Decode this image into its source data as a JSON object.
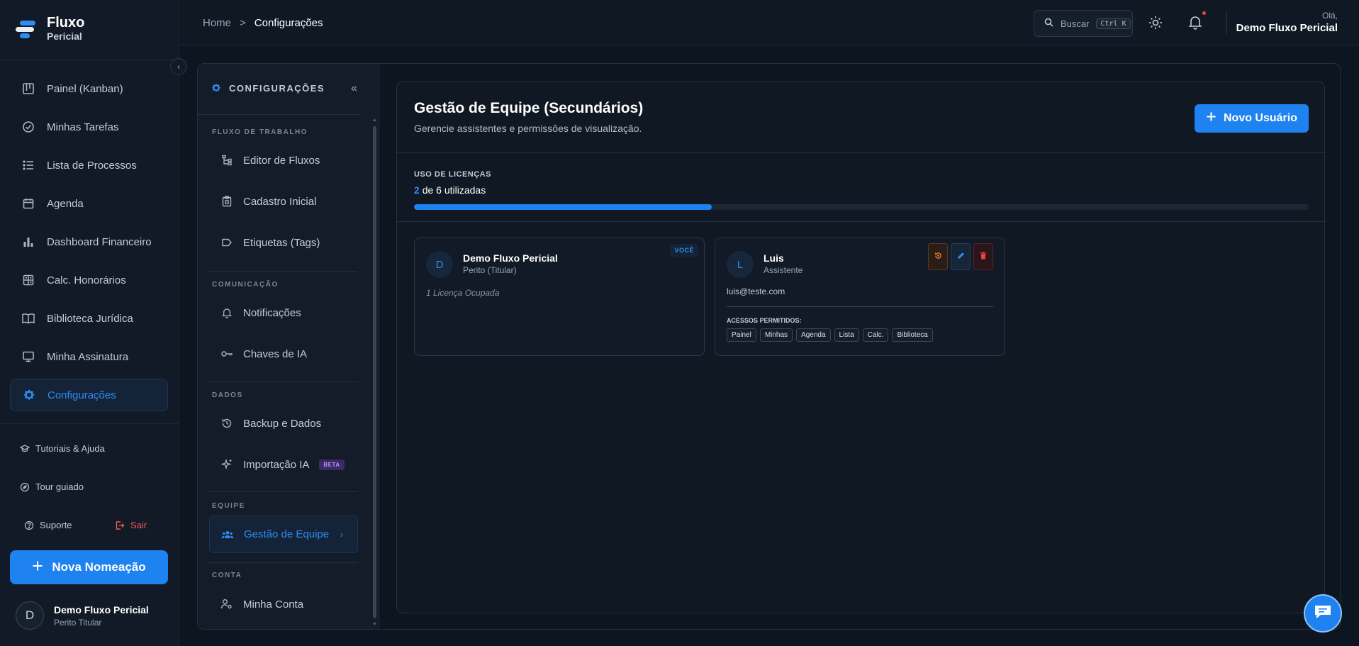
{
  "app": {
    "logo_line1": "Fluxo",
    "logo_line2": "Pericial"
  },
  "sidebar": {
    "items": [
      {
        "label": "Painel (Kanban)",
        "icon": "kanban-icon"
      },
      {
        "label": "Minhas Tarefas",
        "icon": "check-circle-icon"
      },
      {
        "label": "Lista de Processos",
        "icon": "list-icon"
      },
      {
        "label": "Agenda",
        "icon": "calendar-icon"
      },
      {
        "label": "Dashboard Financeiro",
        "icon": "bar-chart-icon"
      },
      {
        "label": "Calc. Honorários",
        "icon": "calculator-icon"
      },
      {
        "label": "Biblioteca Jurídica",
        "icon": "book-icon"
      },
      {
        "label": "Minha Assinatura",
        "icon": "monitor-icon"
      },
      {
        "label": "Configurações",
        "icon": "gear-icon",
        "active": true
      }
    ],
    "tutorials": "Tutoriais & Ajuda",
    "tour": "Tour guiado",
    "support": "Suporte",
    "logout": "Sair",
    "new_button": "Nova Nomeação",
    "user_name": "Demo Fluxo Pericial",
    "user_role": "Perito Titular",
    "user_initial": "D"
  },
  "topbar": {
    "breadcrumb_home": "Home",
    "breadcrumb_sep": ">",
    "breadcrumb_current": "Configurações",
    "search_label": "Buscar",
    "search_shortcut": "Ctrl K",
    "greeting": "Olá,",
    "user_name": "Demo Fluxo Pericial"
  },
  "settings_nav": {
    "title": "CONFIGURAÇÕES",
    "sections": {
      "workflow": "FLUXO DE TRABALHO",
      "communication": "COMUNICAÇÃO",
      "data": "DADOS",
      "team": "EQUIPE",
      "account": "CONTA"
    },
    "items": {
      "flow_editor": "Editor de Fluxos",
      "initial_register": "Cadastro Inicial",
      "tags": "Etiquetas (Tags)",
      "notifications": "Notificações",
      "ai_keys": "Chaves de IA",
      "backup": "Backup e Dados",
      "ai_import": "Importação IA",
      "team_mgmt": "Gestão de Equipe",
      "my_account": "Minha Conta"
    },
    "beta_badge": "BETA"
  },
  "team": {
    "title": "Gestão de Equipe (Secundários)",
    "subtitle": "Gerencie assistentes e permissões de visualização.",
    "new_user_button": "Novo Usuário",
    "license_label": "USO DE LICENÇAS",
    "license_used": "2",
    "license_rest": "de 6 utilizadas",
    "license_fraction": 0.333,
    "members": [
      {
        "initial": "D",
        "name": "Demo Fluxo Pericial",
        "role": "Perito (Titular)",
        "badge": "VOCÊ",
        "note": "1 Licença Ocupada"
      },
      {
        "initial": "L",
        "name": "Luis",
        "role": "Assistente",
        "email": "luis@teste.com",
        "access_label": "ACESSOS PERMITIDOS:",
        "access": [
          "Painel",
          "Minhas",
          "Agenda",
          "Lista",
          "Calc.",
          "Biblioteca"
        ]
      }
    ]
  },
  "colors": {
    "accent": "#1e82f0",
    "background": "#0d1520",
    "danger": "#ef4444",
    "warning": "#f07a2f"
  }
}
